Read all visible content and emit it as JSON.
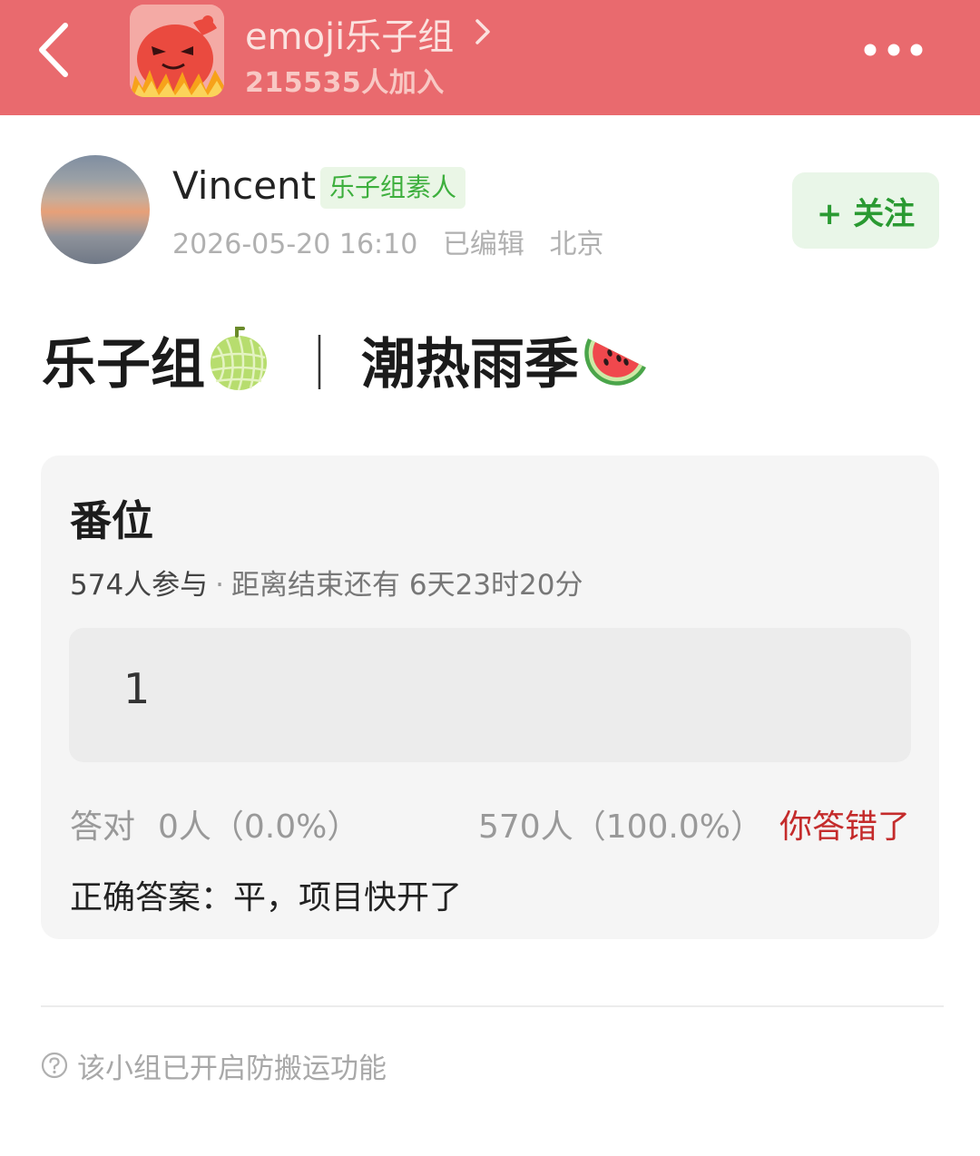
{
  "header": {
    "group_name": "emoji乐子组",
    "member_count": "215535人加入",
    "bar_color": "#e96a6e",
    "back_icon": "chevron-left-icon",
    "chevron_icon": "chevron-right-icon",
    "more_icon": "more-dots-icon"
  },
  "author": {
    "name": "Vincent",
    "badge": "乐子组素人",
    "timestamp": "2026-05-20 16:10",
    "edited": "已编辑",
    "location": "北京",
    "follow_label": "+ 关注"
  },
  "post": {
    "title_part1": "乐子组",
    "title_separator": "｜",
    "title_part2": "潮热雨季",
    "emoji_1": "melon-icon",
    "emoji_2": "watermelon-icon"
  },
  "quiz": {
    "title": "番位",
    "participants": "574人参与",
    "dot": "·",
    "deadline": "距离结束还有 6天23时20分",
    "option_text": "1",
    "correct_label": "答对",
    "correct_count": "0人（0.0%）",
    "wrong_count": "570人（100.0%）",
    "wrong_verdict": "你答错了",
    "correct_answer": "正确答案：平，项目快开了",
    "verdict_color": "#c42b2b"
  },
  "footer": {
    "notice": "该小组已开启防搬运功能",
    "notice_icon": "question-circle-icon"
  }
}
